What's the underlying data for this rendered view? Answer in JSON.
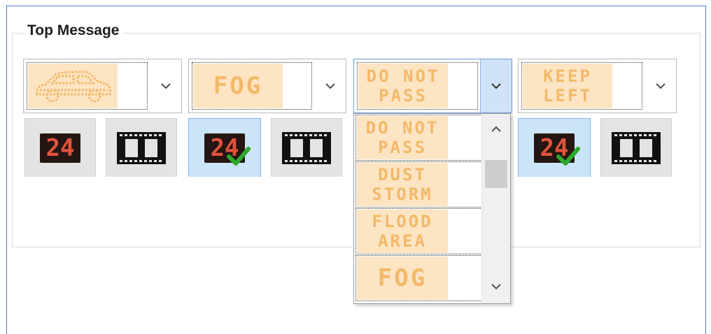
{
  "group": {
    "title": "Top Message"
  },
  "combos": [
    {
      "name": "car",
      "lines": [],
      "icon": "car-outline-icon"
    },
    {
      "name": "fog",
      "lines": [
        "FOG"
      ]
    },
    {
      "name": "do-not-pass",
      "lines": [
        "DO NOT",
        "PASS"
      ],
      "open": true
    },
    {
      "name": "keep-left",
      "lines": [
        "KEEP",
        "LEFT"
      ]
    }
  ],
  "buttons": [
    {
      "name": "counter-button-1",
      "text": "24",
      "checked": false,
      "icon": "led-counter-icon"
    },
    {
      "name": "film-button-1",
      "icon": "film-strip-icon"
    },
    {
      "name": "counter-button-2",
      "text": "24",
      "checked": true,
      "icon": "led-counter-checked-icon"
    },
    {
      "name": "film-button-2",
      "icon": "film-strip-icon"
    },
    {
      "name": "counter-button-3",
      "text": "24",
      "checked": true,
      "icon": "led-counter-checked-icon"
    },
    {
      "name": "film-button-3",
      "icon": "film-strip-icon"
    }
  ],
  "dropdown": {
    "items": [
      {
        "lines": [
          "DO NOT",
          "PASS"
        ]
      },
      {
        "lines": [
          "DUST",
          "STORM"
        ]
      },
      {
        "lines": [
          "FLOOD",
          "AREA"
        ]
      },
      {
        "lines": [
          "FOG"
        ]
      }
    ],
    "scroll_up_icon": "chevron-up-icon",
    "scroll_down_icon": "chevron-down-icon"
  },
  "colors": {
    "led_background": "#fde4c2",
    "led_text": "#f2b96a",
    "counter_digits": "#e2533c",
    "check_mark": "#2ca82c",
    "accent": "#4a7cc4"
  }
}
